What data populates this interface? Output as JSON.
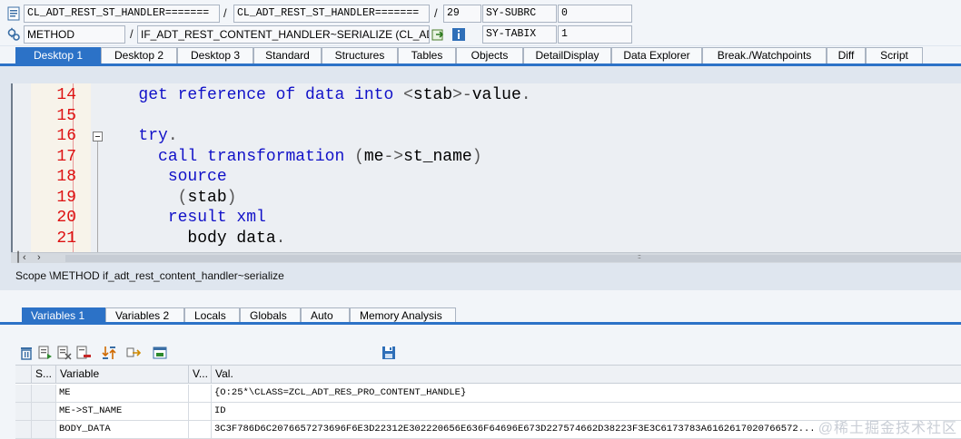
{
  "info": {
    "program": "CL_ADT_REST_ST_HANDLER=======",
    "include": "CL_ADT_REST_ST_HANDLER=======",
    "line": "29",
    "sy_subrc_label": "SY-SUBRC",
    "sy_subrc_value": "0",
    "event_type": "METHOD",
    "event": "IF_ADT_REST_CONTENT_HANDLER~SERIALIZE (CL_AD...",
    "sy_tabix_label": "SY-TABIX",
    "sy_tabix_value": "1",
    "slash": "/"
  },
  "tabs": [
    "Desktop 1",
    "Desktop 2",
    "Desktop 3",
    "Standard",
    "Structures",
    "Tables",
    "Objects",
    "DetailDisplay",
    "Data Explorer",
    "Break./Watchpoints",
    "Diff",
    "Script"
  ],
  "editor": {
    "lines": [
      {
        "num": "14",
        "indent": "   ",
        "parts": [
          [
            "get reference of data into",
            "kw"
          ],
          [
            " ",
            ""
          ],
          [
            "<",
            "op"
          ],
          [
            "stab",
            ""
          ],
          [
            ">",
            "op"
          ],
          [
            "-",
            "op"
          ],
          [
            "value",
            ""
          ],
          [
            ".",
            "op"
          ]
        ]
      },
      {
        "num": "15",
        "indent": "",
        "parts": []
      },
      {
        "num": "16",
        "indent": "   ",
        "parts": [
          [
            "try",
            "kw"
          ],
          [
            ".",
            "op"
          ]
        ]
      },
      {
        "num": "17",
        "indent": "     ",
        "parts": [
          [
            "call transformation",
            "kw"
          ],
          [
            " ",
            ""
          ],
          [
            "(",
            "op"
          ],
          [
            "me",
            ""
          ],
          [
            "->",
            "op"
          ],
          [
            "st_name",
            ""
          ],
          [
            ")",
            "op"
          ]
        ]
      },
      {
        "num": "18",
        "indent": "      ",
        "parts": [
          [
            "source",
            "kw"
          ]
        ]
      },
      {
        "num": "19",
        "indent": "       ",
        "parts": [
          [
            "(",
            "op"
          ],
          [
            "stab",
            ""
          ],
          [
            ")",
            "op"
          ]
        ]
      },
      {
        "num": "20",
        "indent": "      ",
        "parts": [
          [
            "result xml",
            "kw"
          ]
        ]
      },
      {
        "num": "21",
        "indent": "        ",
        "parts": [
          [
            "body data",
            ""
          ],
          [
            ".",
            "op"
          ]
        ]
      }
    ]
  },
  "scope_text": "Scope \\METHOD if_adt_rest_content_handler~serialize",
  "var_tabs": [
    "Variables 1",
    "Variables 2",
    "Locals",
    "Globals",
    "Auto",
    "Memory Analysis"
  ],
  "table": {
    "headers": [
      "S...",
      "Variable",
      "V...",
      "Val."
    ],
    "rows": [
      {
        "variable": "ME",
        "value": "{O:25*\\CLASS=ZCL_ADT_RES_PRO_CONTENT_HANDLE}"
      },
      {
        "variable": "ME->ST_NAME",
        "value": "ID"
      },
      {
        "variable": "BODY_DATA",
        "value": "3C3F786D6C2076657273696F6E3D22312E302220656E636F64696E673D227574662D38223F3E3C6173783A6162617020766572..."
      }
    ]
  },
  "watermark": "@稀土掘金技术社区",
  "colors": {
    "accent": "#2c72c7",
    "keyword": "#1111c8",
    "line_number": "#dd1111"
  }
}
